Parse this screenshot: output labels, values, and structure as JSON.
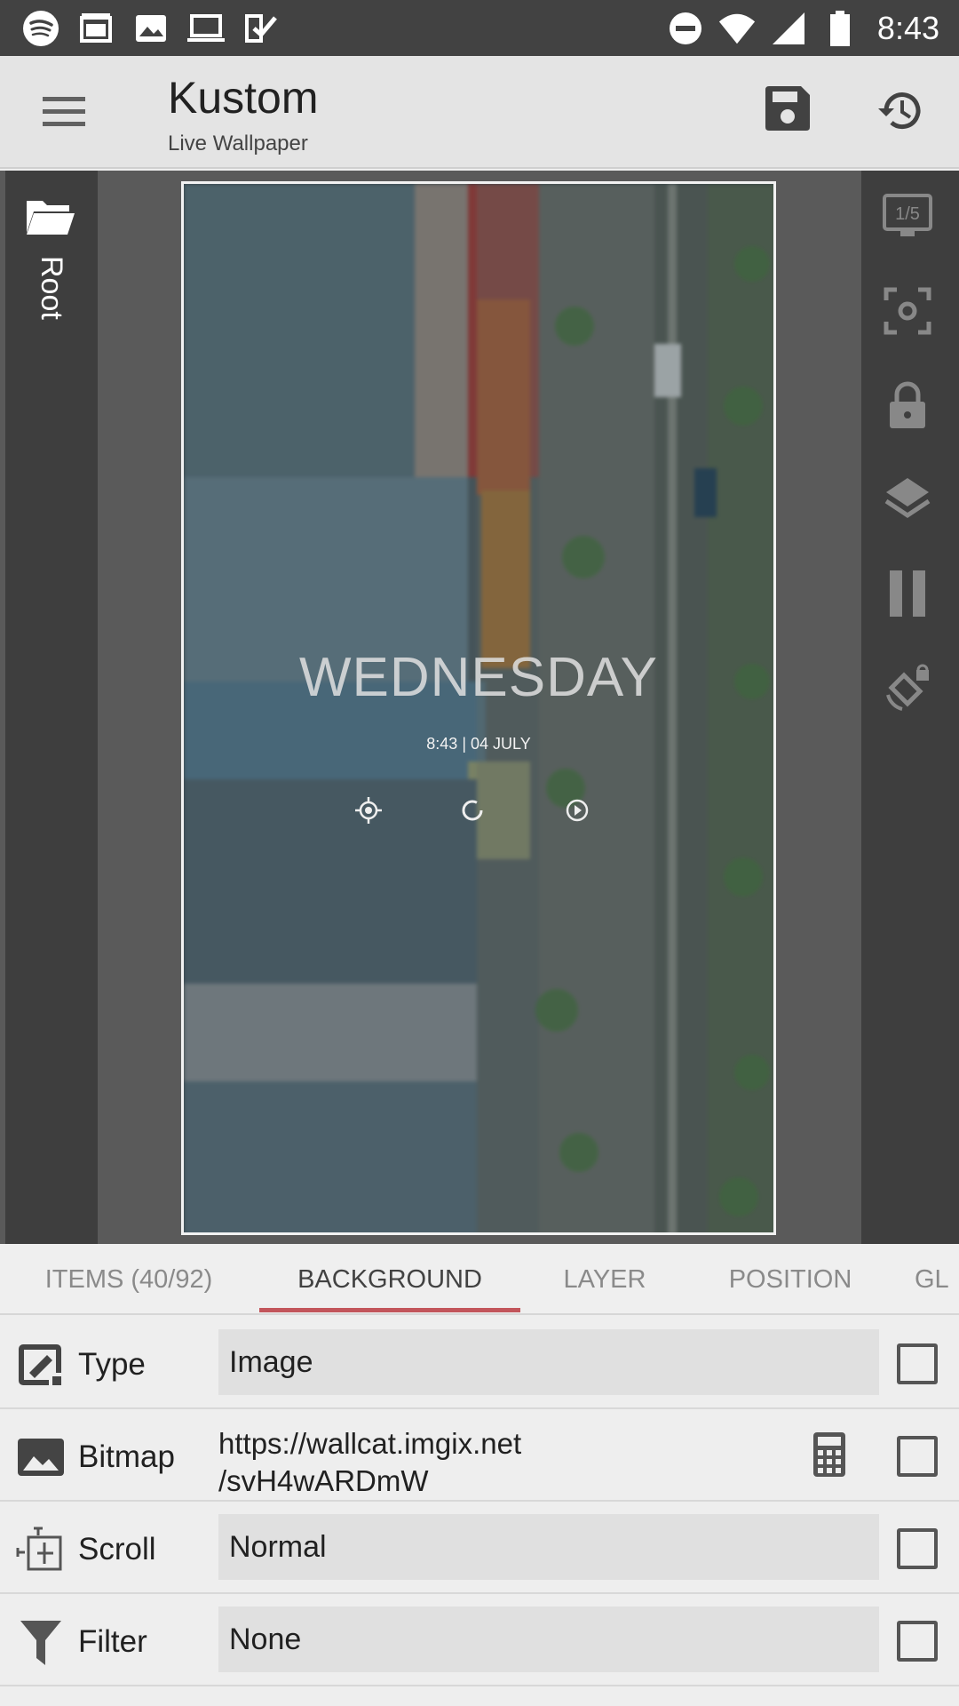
{
  "status_bar": {
    "time": "8:43",
    "left_icons": [
      "spotify-icon",
      "cast-icon",
      "gallery-icon",
      "laptop-icon",
      "tasks-icon"
    ],
    "right_icons": [
      "do-not-disturb-icon",
      "wifi-icon",
      "signal-icon",
      "battery-icon"
    ]
  },
  "app_bar": {
    "title": "Kustom",
    "subtitle": "Live Wallpaper"
  },
  "left_rail": {
    "label": "Root"
  },
  "right_rail": {
    "page_indicator": "1/5",
    "icons": [
      "screenshot-icon",
      "lock-icon",
      "layers-icon",
      "pause-icon",
      "rotate-lock-icon"
    ]
  },
  "preview": {
    "weekday": "WEDNESDAY",
    "time_date": "8:43 | 04 JULY",
    "controls": [
      "target-icon",
      "refresh-icon",
      "play-icon"
    ]
  },
  "tabs": [
    {
      "label": "ITEMS (40/92)",
      "active": false
    },
    {
      "label": "BACKGROUND",
      "active": true
    },
    {
      "label": "LAYER",
      "active": false
    },
    {
      "label": "POSITION",
      "active": false
    },
    {
      "label": "GL",
      "active": false
    }
  ],
  "properties": [
    {
      "label": "Type",
      "value": "Image",
      "icon": "type-icon"
    },
    {
      "label": "Bitmap",
      "value_line1": "https://wallcat.imgix.net",
      "value_line2": "/svH4wARDmW",
      "icon": "image-icon"
    },
    {
      "label": "Scroll",
      "value": "Normal",
      "icon": "scroll-icon"
    },
    {
      "label": "Filter",
      "value": "None",
      "icon": "filter-icon"
    }
  ],
  "colors": {
    "status_bar": "#424242",
    "app_bar": "#e4e4e4",
    "accent": "#c2555b",
    "rail": "#3e3e3e"
  }
}
